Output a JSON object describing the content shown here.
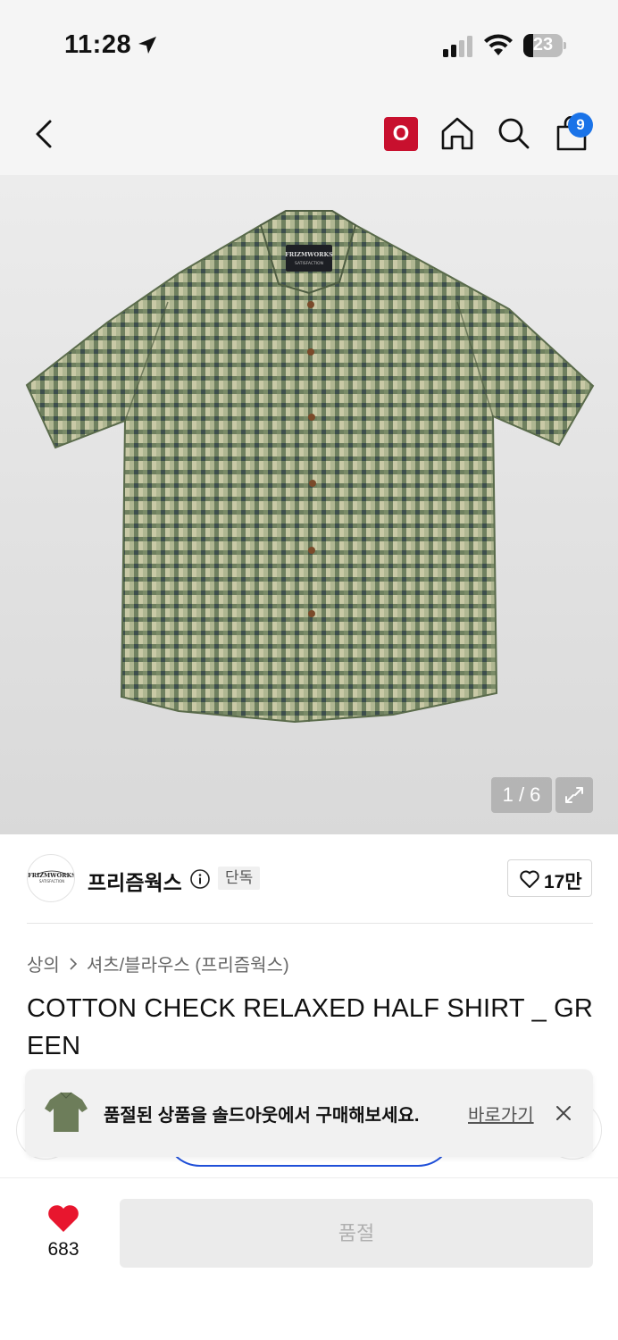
{
  "status_bar": {
    "time": "11:28",
    "battery": "23"
  },
  "nav": {
    "o_badge": "O",
    "cart_count": "9"
  },
  "hero": {
    "page_indicator": "1 / 6",
    "image_alt": "FRIZMWORKS SATISFACTION"
  },
  "brand": {
    "name": "프리즘웍스",
    "exclusive": "단독",
    "likes": "17만",
    "logo_text": "FRIZMWORKS"
  },
  "breadcrumb": {
    "level1": "상의",
    "level2": "셔츠/블라우스 (프리즘웍스)"
  },
  "product": {
    "title": "COTTON CHECK RELAXED HALF SHIRT _ GREEN"
  },
  "toast": {
    "message": "품절된 상품을 솔드아웃에서 구매해보세요.",
    "link": "바로가기"
  },
  "bottom": {
    "wish_count": "683",
    "buy_label": "품절"
  },
  "colors": {
    "accent_red": "#c8102e",
    "badge_blue": "#1a73e8",
    "heart_red": "#e8162e",
    "shirt_green": "#6d7d5a"
  }
}
